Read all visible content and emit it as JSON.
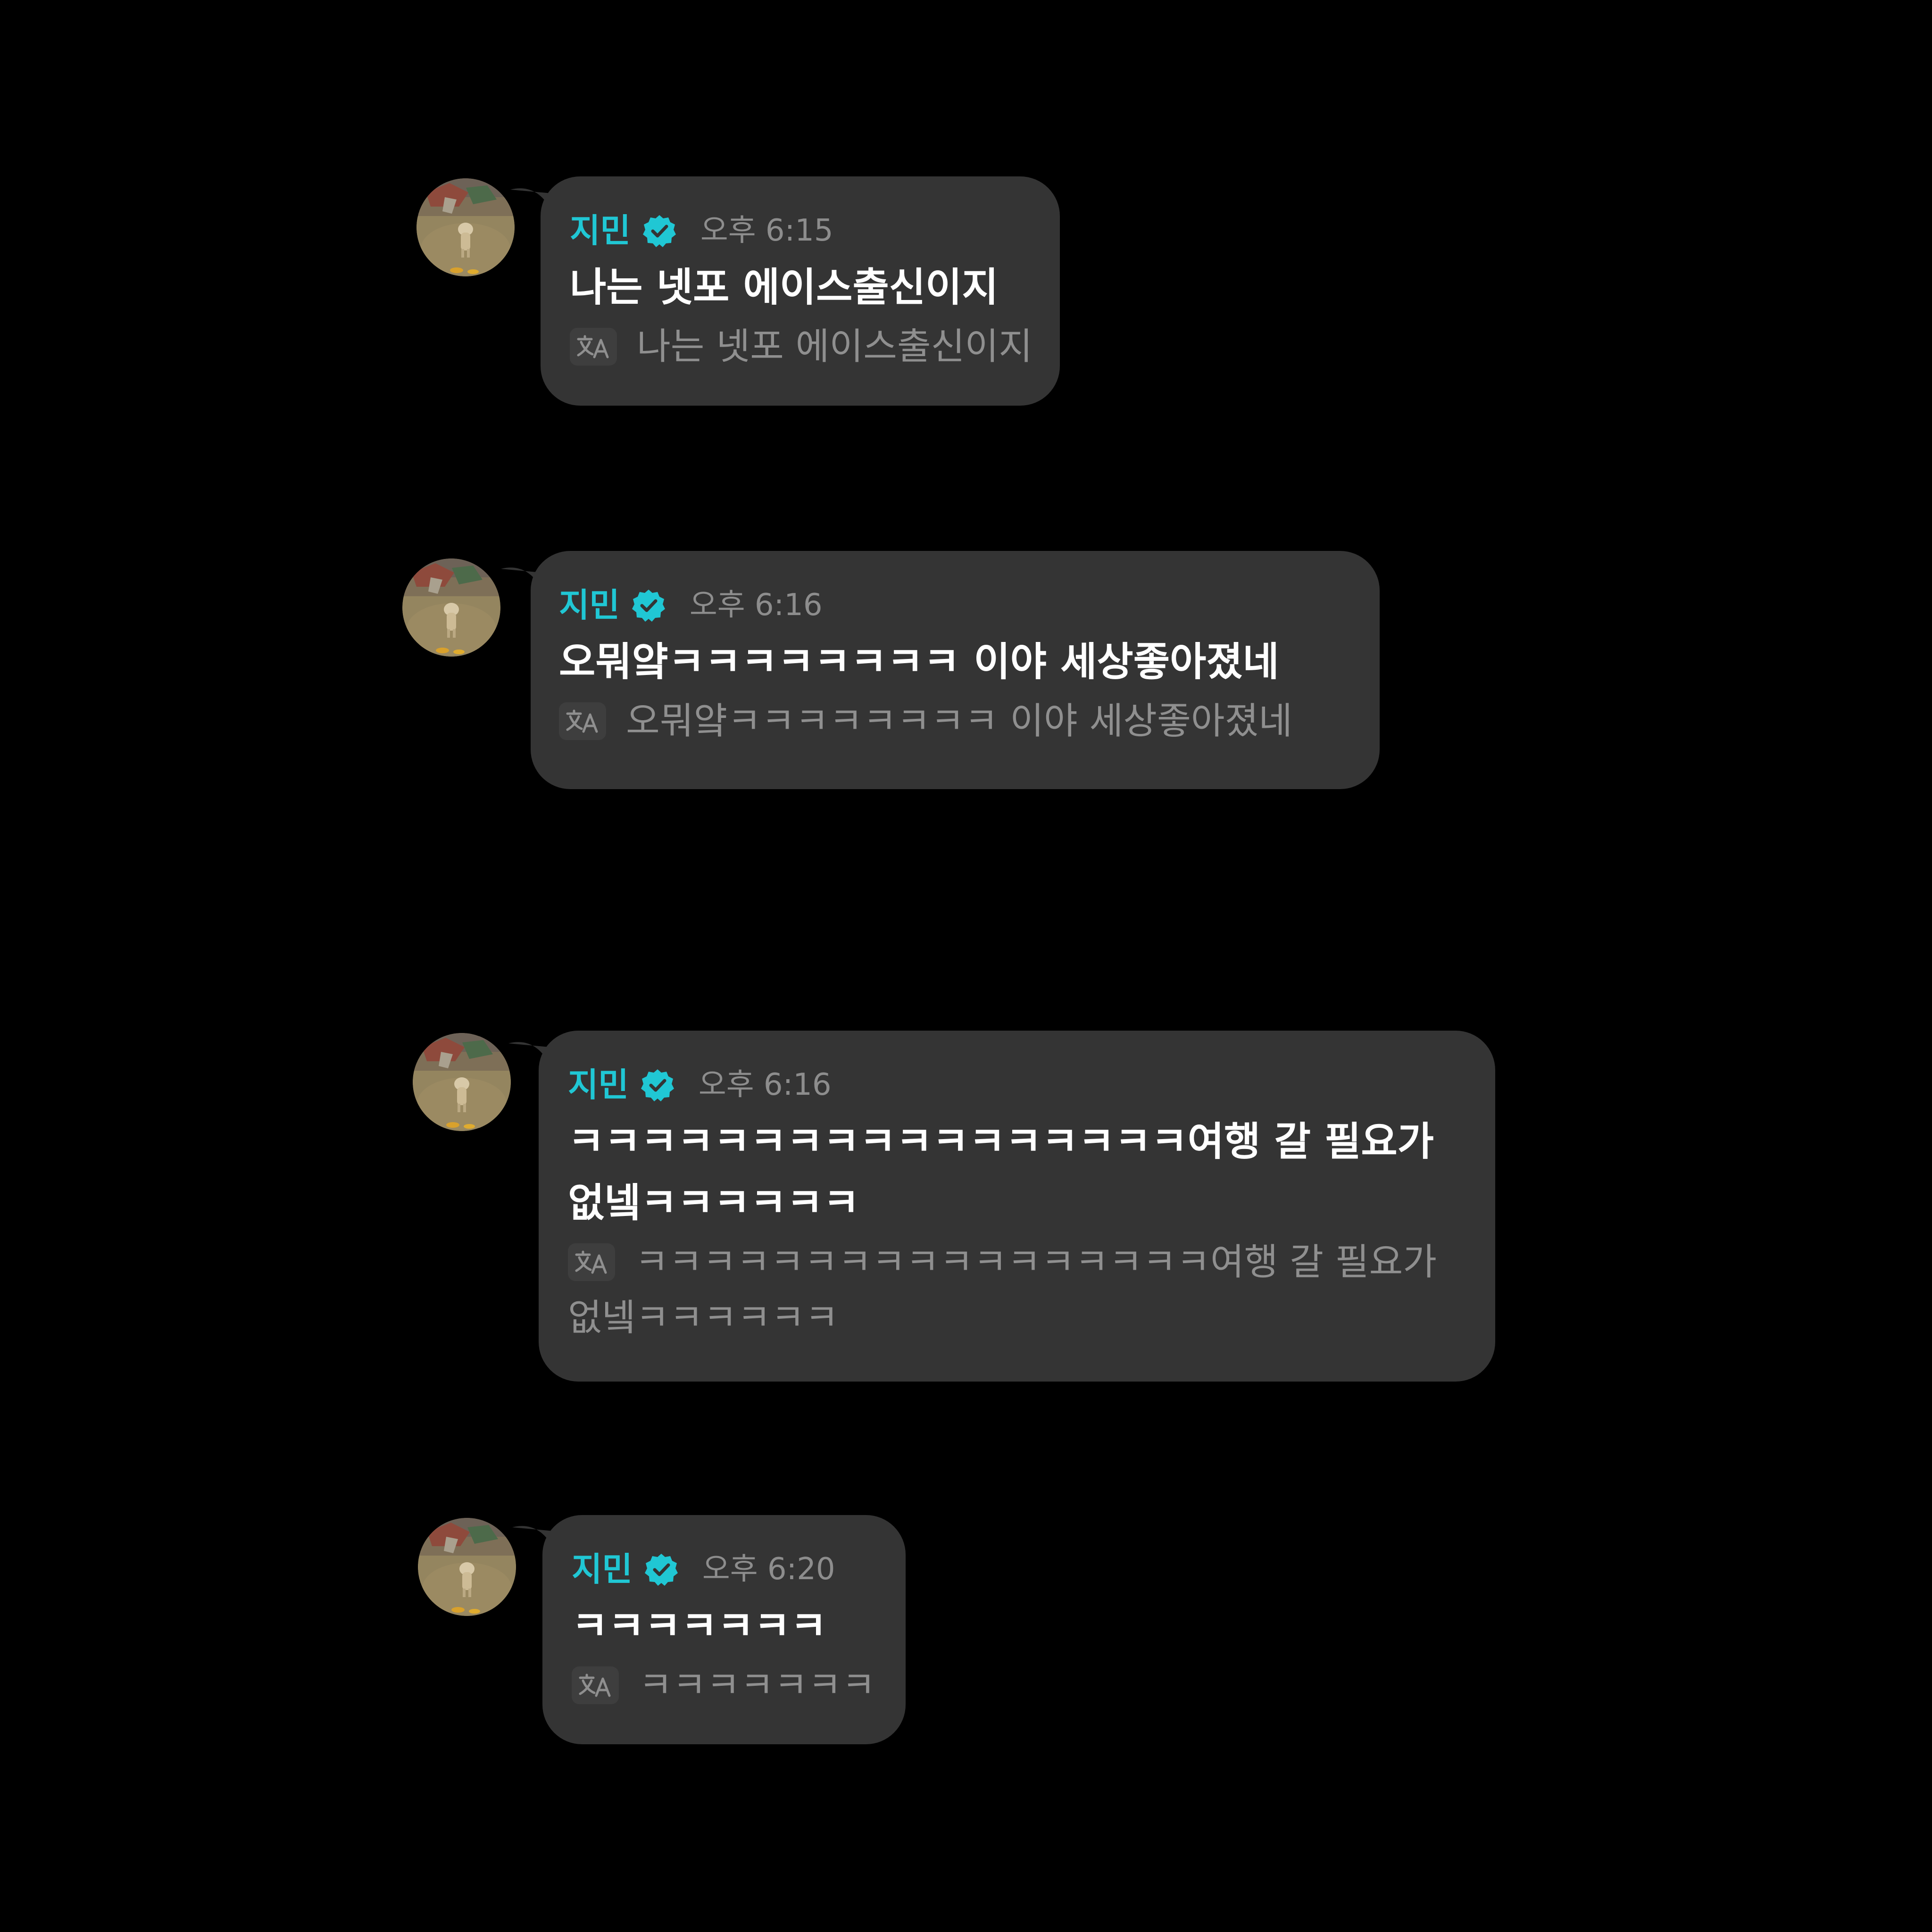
{
  "colors": {
    "background": "#000000",
    "bubble": "#343434",
    "sender_name": "#20c7d4",
    "verified_badge": "#20c7d4",
    "message_text": "#ffffff",
    "timestamp": "#8d8d8d",
    "translation_text": "#8f8f8f"
  },
  "messages": [
    {
      "sender": "지민",
      "verified_icon": "verified-badge-icon",
      "time": "오후 6:15",
      "text": "나는 넷포 에이스출신이지",
      "translation_icon": "translate-icon",
      "translation": "나는 넷포 에이스출신이지"
    },
    {
      "sender": "지민",
      "verified_icon": "verified-badge-icon",
      "time": "오후 6:16",
      "text": "오뭐얔ㅋㅋㅋㅋㅋㅋㅋㅋ 이야 세상좋아졌네",
      "translation_icon": "translate-icon",
      "translation": "오뭐얔ㅋㅋㅋㅋㅋㅋㅋㅋ 이야 세상좋아졌네"
    },
    {
      "sender": "지민",
      "verified_icon": "verified-badge-icon",
      "time": "오후 6:16",
      "text": "ㅋㅋㅋㅋㅋㅋㅋㅋㅋㅋㅋㅋㅋㅋㅋㅋㅋ여행 갈 필요가 없넼ㅋㅋㅋㅋㅋㅋ",
      "translation_icon": "translate-icon",
      "translation": "ㅋㅋㅋㅋㅋㅋㅋㅋㅋㅋㅋㅋㅋㅋㅋㅋㅋ여행 갈 필요가 없넼ㅋㅋㅋㅋㅋㅋ"
    },
    {
      "sender": "지민",
      "verified_icon": "verified-badge-icon",
      "time": "오후 6:20",
      "text": "ㅋㅋㅋㅋㅋㅋㅋ",
      "translation_icon": "translate-icon",
      "translation": "ㅋㅋㅋㅋㅋㅋㅋ"
    }
  ]
}
